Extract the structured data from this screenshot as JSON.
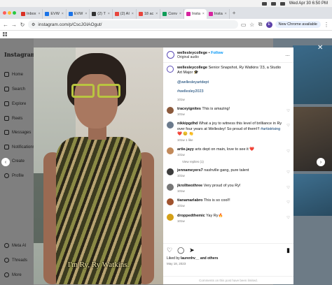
{
  "menubar": {
    "datetime": "Wed Apr 30  6:50 PM"
  },
  "tabs": [
    {
      "label": "Inbox",
      "color": "#d93025"
    },
    {
      "label": "EVW",
      "color": "#1a73e8"
    },
    {
      "label": "EVW",
      "color": "#1a73e8"
    },
    {
      "label": "(2) T",
      "color": "#333333"
    },
    {
      "label": "(2) AI",
      "color": "#e8453c"
    },
    {
      "label": "18 ac",
      "color": "#e8453c"
    },
    {
      "label": "Conv",
      "color": "#0f9d58"
    },
    {
      "label": "Insta",
      "color": "#d6249f",
      "active": true
    },
    {
      "label": "Insta",
      "color": "#d6249f"
    }
  ],
  "address": {
    "url": "instagram.com/p/CscJGlAOgut/",
    "new_chrome": "New Chrome available",
    "profile_initial": "E"
  },
  "instagram_nav": {
    "logo": "Instagram",
    "items": [
      "Home",
      "Search",
      "Explore",
      "Reels",
      "Messages",
      "Notifications",
      "Create",
      "Profile"
    ],
    "bottom": [
      "Meta AI",
      "Threads",
      "More"
    ]
  },
  "video": {
    "caption": "I'm Ry, Ry Watkins."
  },
  "post": {
    "username": "wellesleycollege",
    "follow": "Follow",
    "audio": "Original audio",
    "caption_user": "wellesleycollege",
    "caption_text": "Senior Snapshot, Ry Watkins '23, a Studio Art Major 🎓",
    "mentions": [
      "@wellesleyartdept",
      "#wellesley2023"
    ],
    "caption_age": "101w",
    "comments": [
      {
        "user": "traceyignites",
        "text": "This is amazing!",
        "age": "101w",
        "likes": "",
        "avatar": "#8b5a3c"
      },
      {
        "user": "nikkipgdhd",
        "text": "What a joy to witness this level of brilliance in Ry over four years at Wellesley! So proud of them!!!",
        "tag": "#artistrising",
        "extra": "❤️ 😊 👏",
        "age": "101w",
        "likes": "1 like",
        "avatar": "#6b7a8c"
      },
      {
        "user": "artie.jayy",
        "text": "arts dept on main, love to see it ❤️",
        "age": "101w",
        "likes": "",
        "avatar": "#c28a5a",
        "replies": "View replies (1)"
      },
      {
        "user": "jennameyers7",
        "text": "nashville gang, pure talent",
        "age": "101w",
        "likes": "",
        "avatar": "#3c3c3c"
      },
      {
        "user": "jkrolltwothree",
        "text": "Very proud of you Ry!",
        "age": "101w",
        "likes": "",
        "avatar": "#777777"
      },
      {
        "user": "tianamarlabro",
        "text": "This is so cool!!",
        "age": "101w",
        "likes": "",
        "avatar": "#a0522d"
      },
      {
        "user": "droppedthemic",
        "text": "Yay Ry🔥",
        "age": "101w",
        "likes": "",
        "avatar": "#d4a017"
      }
    ],
    "liked_by_prefix": "Liked by",
    "liked_by_user": "laurenhv__",
    "liked_by_suffix": "and others",
    "date": "May 18, 2023",
    "comments_limited": "Comments on this post have been limited."
  }
}
